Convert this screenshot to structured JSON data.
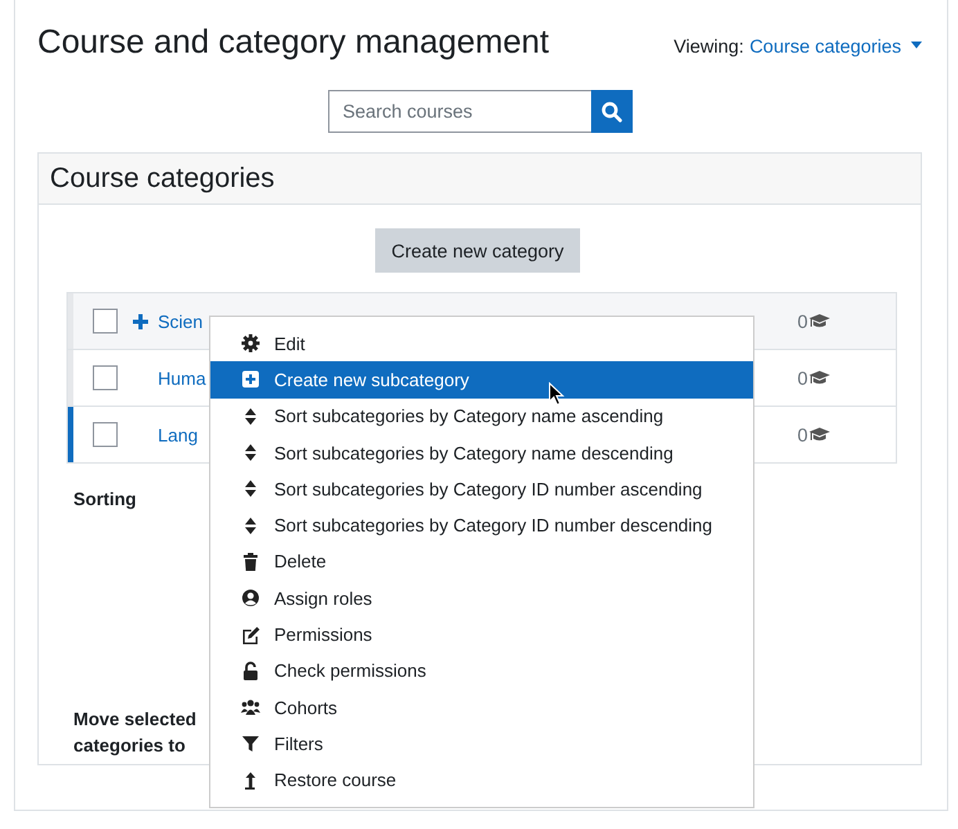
{
  "page": {
    "title": "Course and category management",
    "viewing_label": "Viewing:",
    "viewing_value": "Course categories"
  },
  "search": {
    "placeholder": "Search courses"
  },
  "panel": {
    "title": "Course categories",
    "create_button": "Create new category"
  },
  "categories": [
    {
      "name": "Scien",
      "expandable": true,
      "selected": false,
      "checked": false,
      "count": "0"
    },
    {
      "name": "Huma",
      "expandable": false,
      "selected": false,
      "checked": false,
      "count": "0"
    },
    {
      "name": "Lang",
      "expandable": false,
      "selected": true,
      "checked": false,
      "count": "0"
    }
  ],
  "sorting_label": "Sorting",
  "move_label": "Move selected categories to",
  "menu": [
    {
      "label": "Edit",
      "kind": "gear",
      "selected": false
    },
    {
      "label": "Create new subcategory",
      "kind": "plus",
      "selected": true
    },
    {
      "label": "Sort subcategories by Category name ascending",
      "kind": "sort",
      "selected": false
    },
    {
      "label": "Sort subcategories by Category name descending",
      "kind": "sort",
      "selected": false
    },
    {
      "label": "Sort subcategories by Category ID number ascending",
      "kind": "sort",
      "selected": false
    },
    {
      "label": "Sort subcategories by Category ID number descending",
      "kind": "sort",
      "selected": false
    },
    {
      "label": "Delete",
      "kind": "trash",
      "selected": false
    },
    {
      "label": "Assign roles",
      "kind": "user",
      "selected": false
    },
    {
      "label": "Permissions",
      "kind": "edit",
      "selected": false
    },
    {
      "label": "Check permissions",
      "kind": "lock",
      "selected": false
    },
    {
      "label": "Cohorts",
      "kind": "users",
      "selected": false
    },
    {
      "label": "Filters",
      "kind": "filter",
      "selected": false
    },
    {
      "label": "Restore course",
      "kind": "restore",
      "selected": false
    }
  ]
}
